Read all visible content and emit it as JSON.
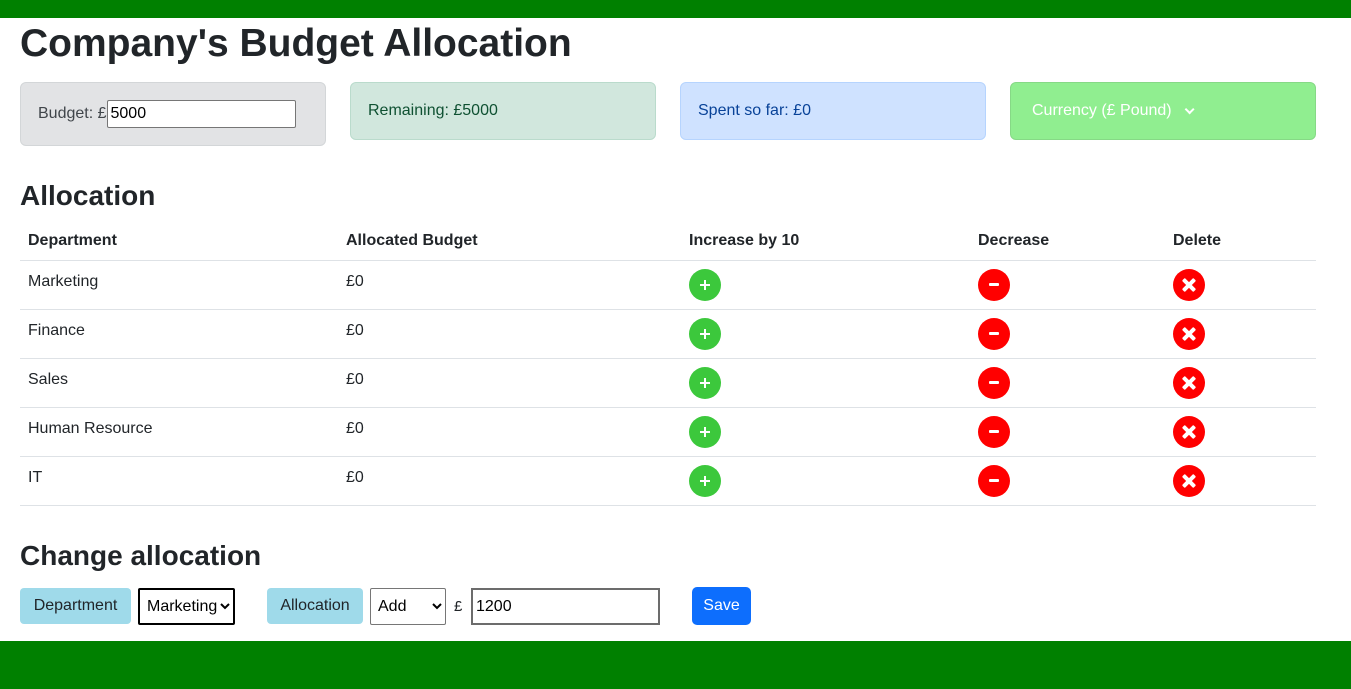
{
  "header": {
    "title": "Company's Budget Allocation"
  },
  "summary": {
    "budget_label": "Budget: £",
    "budget_value": "5000",
    "remaining_text": "Remaining: £5000",
    "spent_text": "Spent so far: £0",
    "currency_text": "Currency (£ Pound)"
  },
  "allocation": {
    "title": "Allocation",
    "columns": [
      "Department",
      "Allocated Budget",
      "Increase by 10",
      "Decrease",
      "Delete"
    ],
    "rows": [
      {
        "department": "Marketing",
        "budget": "£0"
      },
      {
        "department": "Finance",
        "budget": "£0"
      },
      {
        "department": "Sales",
        "budget": "£0"
      },
      {
        "department": "Human Resource",
        "budget": "£0"
      },
      {
        "department": "IT",
        "budget": "£0"
      }
    ]
  },
  "change": {
    "title": "Change allocation",
    "department_label": "Department",
    "department_selected": "Marketing",
    "allocation_label": "Allocation",
    "mode_selected": "Add",
    "currency_symbol": "£",
    "amount_value": "1200",
    "save_label": "Save"
  },
  "colors": {
    "bar_green": "#008000",
    "increase_green": "#3cc83c",
    "decrease_red": "#ff0000",
    "save_blue": "#0d6efd",
    "label_blue": "#9fdaea",
    "currency_green": "#90ee90"
  },
  "icons": {
    "increase": "plus-circle-icon",
    "decrease": "minus-circle-icon",
    "delete": "x-circle-icon"
  }
}
